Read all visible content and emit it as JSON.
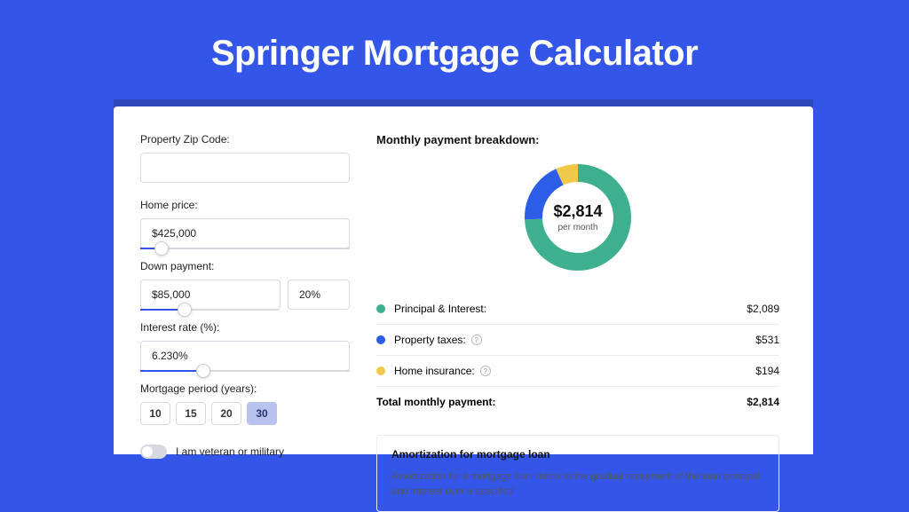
{
  "title": "Springer Mortgage Calculator",
  "form": {
    "zip_label": "Property Zip Code:",
    "zip_value": "",
    "home_price_label": "Home price:",
    "home_price_value": "$425,000",
    "home_price_slider_pct": 10,
    "down_payment_label": "Down payment:",
    "down_payment_value": "$85,000",
    "down_payment_pct": "20%",
    "down_payment_slider_pct": 20,
    "rate_label": "Interest rate (%):",
    "rate_value": "6.230%",
    "rate_slider_pct": 30,
    "period_label": "Mortgage period (years):",
    "periods": [
      "10",
      "15",
      "20",
      "30"
    ],
    "period_selected": "30",
    "veteran_label": "I am veteran or military",
    "veteran_on": false
  },
  "breakdown": {
    "title": "Monthly payment breakdown:",
    "total_display": "$2,814",
    "total_sub": "per month",
    "items": [
      {
        "label": "Principal & Interest:",
        "value": "$2,089",
        "color": "#3fb08f",
        "amount": 2089,
        "info": false
      },
      {
        "label": "Property taxes:",
        "value": "$531",
        "color": "#2d5de6",
        "amount": 531,
        "info": true
      },
      {
        "label": "Home insurance:",
        "value": "$194",
        "color": "#f0c94a",
        "amount": 194,
        "info": true
      }
    ],
    "total_label": "Total monthly payment:",
    "total_value": "$2,814"
  },
  "amort": {
    "title": "Amortization for mortgage loan",
    "text": "Amortization for a mortgage loan refers to the gradual repayment of the loan principal and interest over a specified"
  },
  "chart_data": {
    "type": "pie",
    "title": "Monthly payment breakdown",
    "series": [
      {
        "name": "Principal & Interest",
        "value": 2089,
        "color": "#3fb08f"
      },
      {
        "name": "Property taxes",
        "value": 531,
        "color": "#2d5de6"
      },
      {
        "name": "Home insurance",
        "value": 194,
        "color": "#f0c94a"
      }
    ],
    "center_label": "$2,814 per month"
  }
}
